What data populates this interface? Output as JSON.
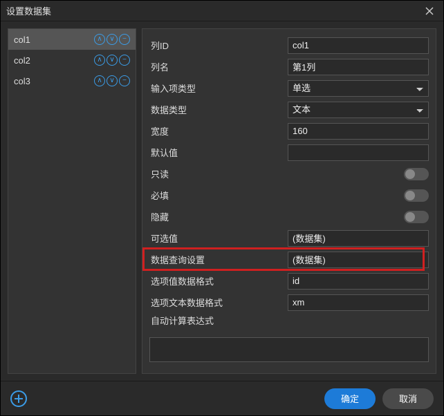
{
  "dialog": {
    "title": "设置数据集"
  },
  "sidebar": {
    "items": [
      {
        "name": "col1",
        "active": true
      },
      {
        "name": "col2",
        "active": false
      },
      {
        "name": "col3",
        "active": false
      }
    ]
  },
  "form": {
    "col_id": {
      "label": "列ID",
      "value": "col1"
    },
    "col_name": {
      "label": "列名",
      "value": "第1列"
    },
    "input_type": {
      "label": "输入项类型",
      "value": "单选"
    },
    "data_type": {
      "label": "数据类型",
      "value": "文本"
    },
    "width": {
      "label": "宽度",
      "value": "160"
    },
    "default_value": {
      "label": "默认值",
      "value": ""
    },
    "readonly": {
      "label": "只读",
      "value": false
    },
    "required": {
      "label": "必填",
      "value": false
    },
    "hidden": {
      "label": "隐藏",
      "value": false
    },
    "options": {
      "label": "可选值",
      "value": "(数据集)"
    },
    "query_settings": {
      "label": "数据查询设置",
      "value": "(数据集)"
    },
    "option_value_fmt": {
      "label": "选项值数据格式",
      "value": "id"
    },
    "option_text_fmt": {
      "label": "选项文本数据格式",
      "value": "xm"
    },
    "auto_calc_expr": {
      "label": "自动计算表达式",
      "value": ""
    }
  },
  "footer": {
    "ok": "确定",
    "cancel": "取消"
  }
}
